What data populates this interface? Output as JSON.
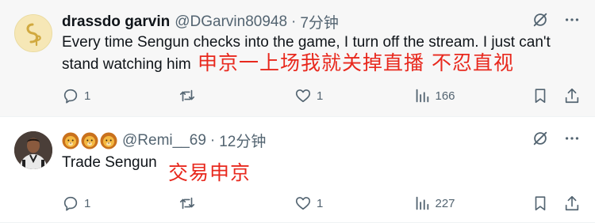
{
  "tweets": [
    {
      "author_name": "drassdo garvin",
      "handle": "@DGarvin80948",
      "separator": "·",
      "time": "7分钟",
      "text": "Every time Sengun checks into the game, I turn off the stream. I just can't stand watching him",
      "overlay_text": "申京一上场我就关掉直播 不忍直视",
      "reply_count": "1",
      "retweet_count": "",
      "like_count": "1",
      "view_count": "166"
    },
    {
      "author_name": "🦁🦁🦁",
      "handle": "@Remi__69",
      "separator": "·",
      "time": "12分钟",
      "text": "Trade Sengun",
      "overlay_text": "交易申京",
      "reply_count": "1",
      "retweet_count": "",
      "like_count": "1",
      "view_count": "227"
    }
  ],
  "icons": {
    "grok": "grok-icon",
    "more": "more-icon",
    "reply": "reply-icon",
    "retweet": "retweet-icon",
    "like": "like-icon",
    "views": "views-icon",
    "bookmark": "bookmark-icon",
    "share": "share-icon"
  },
  "colors": {
    "text": "#0f1419",
    "muted": "#536471",
    "overlay_red": "#e8281d",
    "highlight_bg": "#f7f7f7"
  }
}
